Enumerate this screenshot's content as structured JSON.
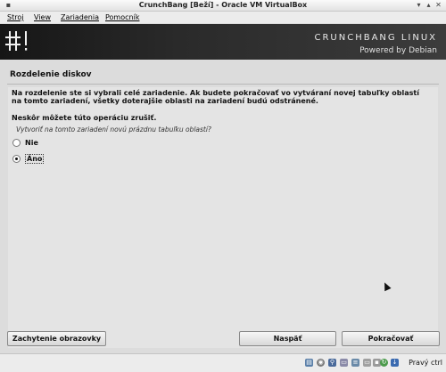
{
  "window": {
    "title": "CrunchBang [Beží] - Oracle VM VirtualBox"
  },
  "menu": {
    "items": [
      "Stroj",
      "View",
      "Zariadenia",
      "Pomocník"
    ]
  },
  "banner": {
    "logo": "#!",
    "brand": "CRUNCHBANG LINUX",
    "powered": "Powered by Debian"
  },
  "installer": {
    "section_title": "Rozdelenie diskov",
    "message": "Na rozdelenie ste si vybrali celé zariadenie. Ak budete pokračovať vo vytváraní novej tabuľky oblastí na tomto zariadení, všetky doterajšie oblasti na zariadení budú odstránené.",
    "message2": "Neskôr môžete túto operáciu zrušiť.",
    "question": "Vytvoriť na tomto zariadení novú prázdnu tabuľku oblastí?",
    "options": [
      {
        "label": "Nie",
        "selected": false
      },
      {
        "label": "Áno",
        "selected": true
      }
    ]
  },
  "buttons": {
    "screenshot": "Zachytenie obrazovky",
    "back": "Naspäť",
    "continue": "Pokračovať"
  },
  "statusbar": {
    "icons": [
      "hdd-icon",
      "cdrom-icon",
      "usb-icon",
      "shared-folder-icon",
      "network-icon",
      "display-icon",
      "recording-icon",
      "mouse-integration-icon",
      "host-key-arrow-icon"
    ],
    "host_key": "Pravý ctrl"
  }
}
